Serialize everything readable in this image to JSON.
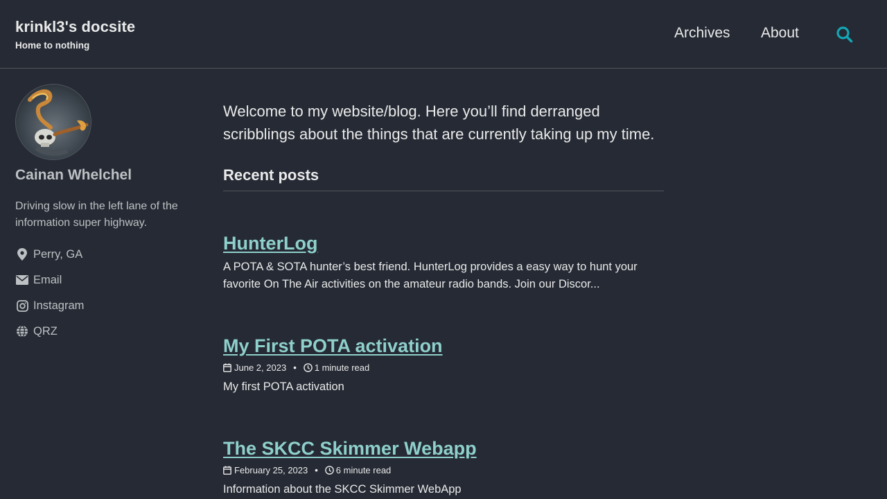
{
  "masthead": {
    "title": "krinkl3's docsite",
    "subtitle": "Home to nothing",
    "nav": [
      {
        "label": "Archives"
      },
      {
        "label": "About"
      }
    ],
    "search_icon": "search-icon",
    "accent_color": "#13a6b4"
  },
  "author": {
    "name": "Cainan Whelchel",
    "bio": "Driving slow in the left lane of the information super highway.",
    "links": [
      {
        "label": "Perry, GA",
        "icon": "map-marker-icon"
      },
      {
        "label": "Email",
        "icon": "envelope-icon"
      },
      {
        "label": "Instagram",
        "icon": "instagram-icon"
      },
      {
        "label": "QRZ",
        "icon": "globe-icon"
      }
    ]
  },
  "main": {
    "intro": "Welcome to my website/blog. Here you’ll find derranged scribblings about the things that are currently taking up my time.",
    "recent_heading": "Recent posts",
    "posts": [
      {
        "title": "HunterLog",
        "excerpt": "A POTA & SOTA hunter’s best friend. HunterLog provides a easy way to hunt your favorite On The Air activities on the amateur radio bands. Join our Discor..."
      },
      {
        "title": "My First POTA activation",
        "date": "June 2, 2023",
        "separator": "•",
        "read_time": "1 minute read",
        "excerpt": "My first POTA activation"
      },
      {
        "title": "The SKCC Skimmer Webapp",
        "date": "February 25, 2023",
        "separator": "•",
        "read_time": "6 minute read",
        "excerpt": "Information about the SKCC Skimmer WebApp"
      }
    ]
  },
  "colors": {
    "background": "#252a34",
    "link": "#8fd0cc",
    "muted_text": "#bdc1c4",
    "border": "#51555d"
  }
}
